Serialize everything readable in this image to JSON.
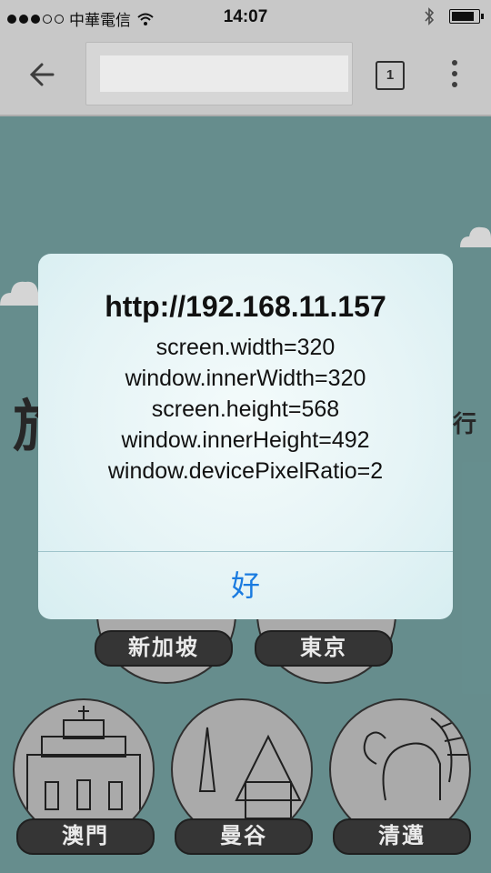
{
  "status_bar": {
    "carrier": "中華電信",
    "time": "14:07",
    "signal_filled": 3,
    "signal_total": 5
  },
  "browser": {
    "tab_count": "1"
  },
  "page": {
    "big_char_left": "旅",
    "big_char_right": "行",
    "cities": [
      "新加坡",
      "東京",
      "澳門",
      "曼谷",
      "清邁"
    ]
  },
  "dialog": {
    "title": "http://192.168.11.157",
    "lines": [
      "screen.width=320",
      "window.innerWidth=320",
      "screen.height=568",
      "window.innerHeight=492",
      "window.devicePixelRatio=2"
    ],
    "ok_label": "好"
  },
  "colors": {
    "background": "#6f9a9a",
    "dialog_button": "#1a7be0"
  }
}
